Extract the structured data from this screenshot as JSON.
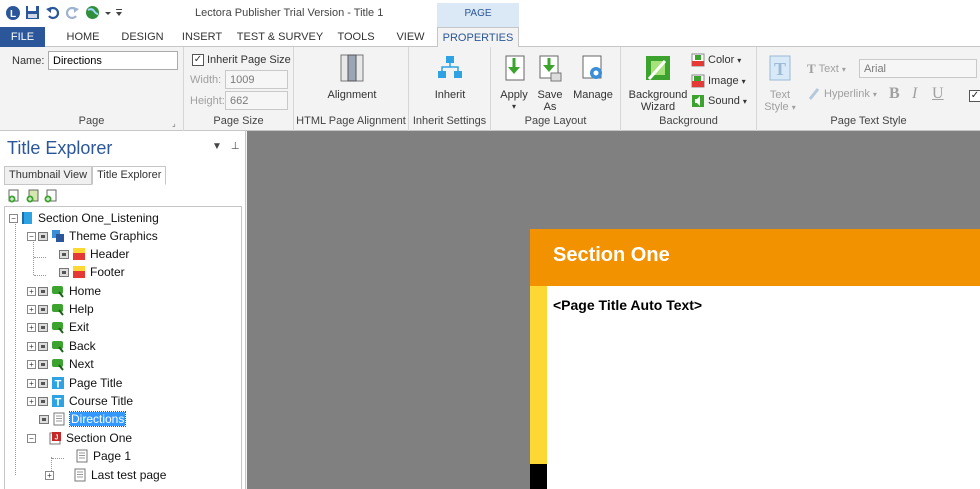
{
  "app": {
    "title": "Lectora Publisher Trial Version - Title 1",
    "context_tab_group": "PAGE"
  },
  "ribbon_tabs": [
    "FILE",
    "HOME",
    "DESIGN",
    "INSERT",
    "TEST & SURVEY",
    "TOOLS",
    "VIEW",
    "PROPERTIES"
  ],
  "ribbon": {
    "page_group": {
      "name_label": "Name:",
      "name_value": "Directions",
      "label": "Page"
    },
    "page_size_group": {
      "inherit_label": "Inherit Page Size",
      "inherit_checked": true,
      "width_label": "Width:",
      "width_value": "1009",
      "height_label": "Height:",
      "height_value": "662",
      "label": "Page Size"
    },
    "alignment_group": {
      "button": "Alignment",
      "label": "HTML Page Alignment"
    },
    "inherit_group": {
      "button": "Inherit",
      "label": "Inherit Settings"
    },
    "layout_group": {
      "apply": "Apply",
      "save_as_1": "Save",
      "save_as_2": "As",
      "manage": "Manage",
      "label": "Page Layout"
    },
    "background_group": {
      "wizard_1": "Background",
      "wizard_2": "Wizard",
      "color": "Color",
      "image": "Image",
      "sound": "Sound",
      "label": "Background"
    },
    "text_style_group": {
      "text_style_1": "Text",
      "text_style_2": "Style",
      "text": "Text",
      "hyperlink": "Hyperlink",
      "font": "Arial",
      "bold": "B",
      "italic": "I",
      "underline": "U",
      "label": "Page Text Style"
    }
  },
  "explorer": {
    "title": "Title Explorer",
    "tabs": [
      "Thumbnail View",
      "Title Explorer"
    ],
    "tree": [
      {
        "label": "Section One_Listening"
      },
      {
        "label": "Theme Graphics"
      },
      {
        "label": "Header"
      },
      {
        "label": "Footer"
      },
      {
        "label": "Home"
      },
      {
        "label": "Help"
      },
      {
        "label": "Exit"
      },
      {
        "label": "Back"
      },
      {
        "label": "Next"
      },
      {
        "label": "Page Title"
      },
      {
        "label": "Course Title"
      },
      {
        "label": "Directions"
      },
      {
        "label": "Section One"
      },
      {
        "label": "Page 1"
      },
      {
        "label": "Last test page"
      }
    ]
  },
  "canvas": {
    "section_header": "Section One",
    "page_title_text": "<Page Title Auto Text>"
  },
  "colors": {
    "accent": "#2b579a",
    "header_orange": "#f39200",
    "sidebar_yellow": "#fdd835",
    "selection": "#3399ff",
    "canvas_gray": "#808080"
  }
}
